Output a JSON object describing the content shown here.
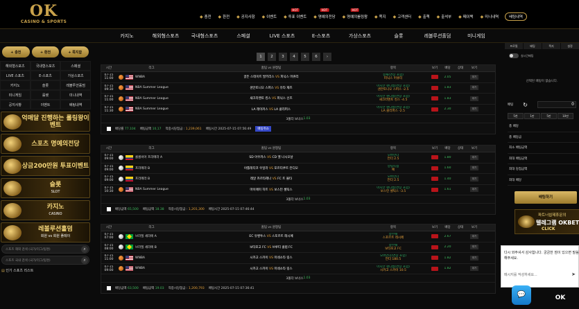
{
  "logo": {
    "main": "OK",
    "sub": "CASINO & SPORTS"
  },
  "topnav": [
    {
      "label": "충전",
      "icon": "coin-icon",
      "hot": false,
      "btn": false
    },
    {
      "label": "환전",
      "icon": "exchange-icon",
      "hot": false,
      "btn": false
    },
    {
      "label": "공지사항",
      "icon": "notice-icon",
      "hot": false,
      "btn": false
    },
    {
      "label": "이벤트",
      "icon": "gift-icon",
      "hot": false,
      "btn": false
    },
    {
      "label": "투표 이벤트",
      "icon": "vote-icon",
      "hot": true,
      "btn": false
    },
    {
      "label": "명예의전당",
      "icon": "trophy-icon",
      "hot": true,
      "btn": false
    },
    {
      "label": "명예의롤링왕",
      "icon": "trophy-icon",
      "hot": true,
      "btn": false
    },
    {
      "label": "쪽지",
      "icon": "mail-icon",
      "hot": false,
      "btn": false
    },
    {
      "label": "고객센터",
      "icon": "support-icon",
      "hot": false,
      "btn": false
    },
    {
      "label": "출첵",
      "icon": "check-icon",
      "hot": false,
      "btn": false
    },
    {
      "label": "출석부",
      "icon": "calendar-icon",
      "hot": false,
      "btn": false
    },
    {
      "label": "페이백",
      "icon": "payback-icon",
      "hot": false,
      "btn": false
    },
    {
      "label": "미니내역",
      "icon": "list-icon",
      "hot": false,
      "btn": false
    },
    {
      "label": "배팅내역",
      "icon": "",
      "hot": false,
      "btn": true
    }
  ],
  "hot_label": "HOT",
  "mainmenu": [
    "카지노",
    "해외형스포츠",
    "국내형스포츠",
    "스페셜",
    "LIVE 스포츠",
    "E-스포츠",
    "가상스포츠",
    "슬롯",
    "레볼루션홀덤",
    "미니게임"
  ],
  "auth": [
    "충전",
    "환전",
    "쪽지함"
  ],
  "categories": [
    "해외형스포츠",
    "국내형스포츠",
    "스페셜",
    "LIVE 스포츠",
    "E-스포츠",
    "가상스포츠",
    "카지노",
    "슬롯",
    "레볼루션홀덤",
    "미니게임",
    "룰렛",
    "미니내역",
    "공지사항",
    "이벤트",
    "배팅내역"
  ],
  "banners": [
    {
      "title": "억매달 진행하는 롤링왕이벤트",
      "sub": ""
    },
    {
      "title": "스포츠 명예의전당",
      "sub": ""
    },
    {
      "title": "상금200만원 투표이벤트",
      "sub": ""
    },
    {
      "title": "슬롯",
      "sub": "SLOT"
    },
    {
      "title": "카지노",
      "sub": "CASINO"
    },
    {
      "title": "레볼루션홀덤",
      "sub": "회원 vs 회원 플레이"
    }
  ],
  "search_inputs": [
    {
      "placeholder": "스포츠 해외 검색 (국가/리그/팀명)"
    },
    {
      "placeholder": "스포츠 국내 검색 (국가/리그/팀명)"
    }
  ],
  "fav_label": "인기 스포츠 리스트",
  "pagination": [
    "1",
    "2",
    "3",
    "4",
    "5",
    "6",
    "›"
  ],
  "headers": {
    "time": "시간",
    "league": "리그",
    "match": "홈팀 vs 원정팀",
    "bet": "항목",
    "view": "보기",
    "odds": "배당",
    "status": "상태",
    "more": "보기"
  },
  "blocks": [
    {
      "rows": [
        {
          "date": "07-15",
          "time": "11:00",
          "flag": "us",
          "ball": "bb",
          "league": "WNBA",
          "home": "골든 스테이트 발키리스",
          "away": "피닉스 머큐리",
          "b1": "승패(연장 포함)",
          "b2": "피닉스 머큐리",
          "odds": "2.05",
          "status": "대기"
        },
        {
          "date": "07-15",
          "time": "09:30",
          "flag": "us",
          "ball": "bb",
          "league": "NBA Summer League",
          "home": "샌안토니오 스퍼스",
          "away": "유타 재즈",
          "b1": "아시안 핸디캡(연장 포함)",
          "b2": "샌안토니오 스퍼스 -2.5",
          "odds": "1.83",
          "status": "대기"
        },
        {
          "date": "07-15",
          "time": "11:00",
          "flag": "us",
          "ball": "bb",
          "league": "NBA Summer League",
          "home": "새크라멘토 킹스",
          "away": "피닉스 선즈",
          "b1": "아시안 핸디캡(연장 포함)",
          "b2": "새크라멘토 킹스 -4.5",
          "odds": "1.83",
          "status": "대기"
        },
        {
          "date": "07-15",
          "time": "11:30",
          "flag": "us",
          "ball": "bb",
          "league": "NBA Summer League",
          "home": "LA 레이커스",
          "away": "LA 클리퍼스",
          "b1": "아시안 핸디캡(연장 포함)",
          "b2": "LA 클리퍼스 -2.5",
          "odds": "2.30",
          "status": "대기"
        }
      ],
      "summary": "3폴더 보너스",
      "summary_val": "1.03",
      "foot": {
        "odds_label": "배당률",
        "odds": "77.104",
        "amount_label": "배팅금액",
        "amount": "10,17",
        "win_label": "적중시당첨금 :",
        "win": "1,239,061",
        "time_label": "배팅시간",
        "time": "2025-07-15 07:56:49",
        "status": "배팅취소"
      }
    },
    {
      "rows": [
        {
          "date": "07-15",
          "time": "09:00",
          "flag": "co",
          "ball": "sc",
          "league": "콜롬비아 프리메라 A",
          "home": "SD 아우카스",
          "away": "CD 엘 나시오날",
          "b1": "오버언더",
          "b2": "언더 2.5",
          "odds": "1.80",
          "status": "대기"
        },
        {
          "date": "07-15",
          "time": "09:00",
          "flag": "co",
          "ball": "sc",
          "league": "프리메라 B",
          "home": "아틀레티코 우일라",
          "away": "포르티쿠트 칸디모",
          "b1": "양팀득점",
          "b2": "예",
          "odds": "1.60",
          "status": "대기"
        },
        {
          "date": "07-15",
          "time": "09:00",
          "flag": "co",
          "ball": "sc",
          "league": "프리메라 B",
          "home": "레알 카르타헤나",
          "away": "FC 트 몰타",
          "b1": "오버언더",
          "b2": "언더 2.5",
          "odds": "1.40",
          "status": "대기"
        },
        {
          "date": "07-15",
          "time": "10:30",
          "flag": "us",
          "ball": "bb",
          "league": "NBA Summer League",
          "home": "마이애미 히트",
          "away": "보스턴 셀틱스",
          "b1": "아시안 핸디캡(연장 포함)",
          "b2": "보스턴 셀틱스 -3.5",
          "odds": "1.61",
          "status": "대기"
        }
      ],
      "summary": "3폴더 보너스",
      "summary_val": "1.03",
      "foot": {
        "odds_label": "배당금액",
        "odds": "65,500",
        "amount_label": "배팅금액",
        "amount": "18.38",
        "win_label": "적중시당첨금 :",
        "win": "1,201,300",
        "time_label": "배팅시간",
        "time": "2025-07-15 07:46:44",
        "status": ""
      }
    },
    {
      "rows": [
        {
          "date": "07-15",
          "time": "07:00",
          "flag": "br",
          "ball": "sc",
          "league": "브라질 세리에 A",
          "home": "EC 유벤투스",
          "away": "스포르트 레시페",
          "b1": "승무패",
          "b2": "스포르트 레시페",
          "odds": "2.67",
          "status": "대기"
        },
        {
          "date": "07-15",
          "time": "08:00",
          "flag": "br",
          "ball": "sc",
          "league": "브라질 세리에 B",
          "home": "보타포고 FC",
          "away": "브루티 클럽 FC",
          "b1": "승무패",
          "b2": "보타포고 FC",
          "odds": "2.20",
          "status": "대기"
        },
        {
          "date": "07-15",
          "time": "11:00",
          "flag": "us",
          "ball": "bb",
          "league": "WNBA",
          "home": "시카고 스카이",
          "away": "미네소타 링스",
          "b1": "오버언더(연장 포함)",
          "b2": "언더 180.5",
          "odds": "1.82",
          "status": "대기"
        },
        {
          "date": "07-15",
          "time": "09:00",
          "flag": "us",
          "ball": "bb",
          "league": "WNBA",
          "home": "시카고 스카이",
          "away": "미네소타 링스",
          "b1": "아시안 핸디캡(연장 포함)",
          "b2": "시카고 스카이 10.5",
          "odds": "1.82",
          "status": "대기"
        }
      ],
      "summary": "3폴더 보너스",
      "summary_val": "1.03",
      "foot": {
        "odds_label": "배당금액",
        "odds": "63,500",
        "amount_label": "배팅금액",
        "amount": "19.03",
        "win_label": "적중시당첨금 :",
        "win": "1,200,793",
        "time_label": "배팅시간",
        "time": "2025-07-15 07:36:41",
        "status": ""
      }
    }
  ],
  "block4_headers": true,
  "rside": {
    "tabs": [
      "프로필",
      "배팅",
      "쪽지",
      "설정"
    ],
    "toggle_label": "실시간배팅",
    "empty": "선택된 배팅이 없습니다.",
    "bet_label": "배팅",
    "amount": "0",
    "quick": [
      "5천",
      "1만",
      "5만",
      "10만"
    ],
    "rows": [
      "총 배당",
      "총 배당금",
      "최소 배팅금액",
      "최대 배팅금액",
      "최대 당첨금액",
      "최대 배당"
    ],
    "bet_button": "배팅하기",
    "banner_t1": "파트너쉽제휴문의",
    "banner_t2": "텔레그램 OKBET",
    "banner_t3": "CLICK"
  },
  "chat": {
    "message": "다시 와주셔서 감사합니다. 궁금한 점이 있으면 말씀해주세요.",
    "placeholder": "메시지를 작성하세요...",
    "fab_label": "💬",
    "ok_label": "OK"
  }
}
